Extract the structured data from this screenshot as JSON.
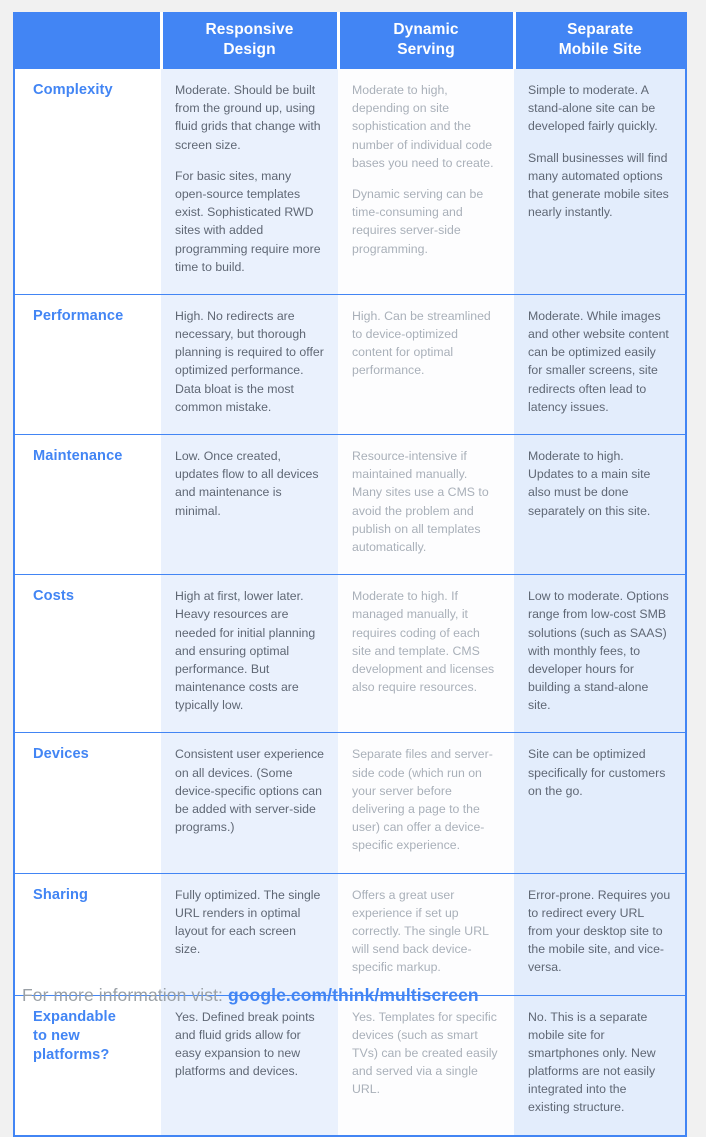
{
  "colors": {
    "header_bg": "#4285f4",
    "accent": "#4285f4",
    "page_bg": "#f1f1f1",
    "col_rwd_bg": "#eaf1fd",
    "col_dyn_bg": "#fdfdfe",
    "col_sep_bg": "#e3edfc",
    "body_text": "#5f6774",
    "muted_text": "#a9b0b9",
    "footer_text": "#9aa0a6"
  },
  "table": {
    "headers": [
      {
        "label": "",
        "lines": [
          "",
          ""
        ]
      },
      {
        "label": "Responsive Design",
        "lines": [
          "Responsive",
          "Design"
        ]
      },
      {
        "label": "Dynamic Serving",
        "lines": [
          "Dynamic",
          "Serving"
        ]
      },
      {
        "label": "Separate Mobile Site",
        "lines": [
          "Separate",
          "Mobile Site"
        ]
      }
    ],
    "rows": [
      {
        "label": "Complexity",
        "label_lines": [
          "Complexity"
        ],
        "responsive": [
          "Moderate. Should be built from the ground up, using fluid grids that change with screen size.",
          "For basic sites, many open-source templates exist. Sophisticated RWD sites with added programming require more time to build."
        ],
        "dynamic": [
          "Moderate to high, depending on site sophistication and the number of individual code bases you need to create.",
          "Dynamic serving can be time-consuming and requires server-side programming."
        ],
        "separate": [
          "Simple to moderate. A stand-alone site can be developed fairly quickly.",
          "Small businesses will find many automated options that generate mobile sites nearly instantly."
        ]
      },
      {
        "label": "Performance",
        "label_lines": [
          "Performance"
        ],
        "responsive": [
          "High. No redirects are necessary, but thorough planning is required to offer optimized performance. Data bloat is the most common mistake."
        ],
        "dynamic": [
          "High. Can be streamlined to device-optimized content for optimal performance."
        ],
        "separate": [
          "Moderate. While images and other website content can be optimized easily for smaller screens, site redirects often lead to latency issues."
        ]
      },
      {
        "label": "Maintenance",
        "label_lines": [
          "Maintenance"
        ],
        "responsive": [
          "Low. Once created, updates flow to all devices and maintenance is minimal."
        ],
        "dynamic": [
          "Resource-intensive if maintained manually. Many sites use a CMS to avoid the problem and publish on all templates automatically."
        ],
        "separate": [
          "Moderate to high. Updates to a main site also must be done separately on this site."
        ]
      },
      {
        "label": "Costs",
        "label_lines": [
          "Costs"
        ],
        "responsive": [
          "High at first, lower later. Heavy resources are needed for initial planning and ensuring optimal performance. But maintenance costs are typically low."
        ],
        "dynamic": [
          "Moderate to high. If managed manually, it requires coding of each site and template. CMS development and licenses also require resources."
        ],
        "separate": [
          "Low to moderate. Options range from low-cost SMB solutions (such as SAAS) with monthly fees, to developer hours for building a stand-alone site."
        ]
      },
      {
        "label": "Devices",
        "label_lines": [
          "Devices"
        ],
        "responsive": [
          "Consistent user experience on all devices. (Some device-specific options can be added with server-side programs.)"
        ],
        "dynamic": [
          "Separate files and server-side code (which run on your server before delivering a page to the user) can offer a device-specific experience."
        ],
        "separate": [
          "Site can be optimized specifically for customers on the go."
        ]
      },
      {
        "label": "Sharing",
        "label_lines": [
          "Sharing"
        ],
        "responsive": [
          "Fully optimized. The single URL renders in optimal layout for each screen size."
        ],
        "dynamic": [
          "Offers a great user experience if set up correctly. The single URL will send back device-specific markup."
        ],
        "separate": [
          "Error-prone. Requires you to redirect every URL from your desktop site to the mobile site, and vice-versa."
        ]
      },
      {
        "label": "Expandable to new platforms?",
        "label_lines": [
          "Expandable",
          "to new",
          "platforms?"
        ],
        "responsive": [
          "Yes. Defined break points and fluid grids allow for easy expansion to new platforms and devices."
        ],
        "dynamic": [
          "Yes. Templates for specific devices (such as smart TVs) can be created easily and served via a single URL."
        ],
        "separate": [
          "No. This is a separate mobile site for smartphones only. New platforms are not easily integrated into the existing structure."
        ]
      }
    ]
  },
  "footer": {
    "prefix": "For more information vist: ",
    "url": "google.com/think/multiscreen"
  }
}
